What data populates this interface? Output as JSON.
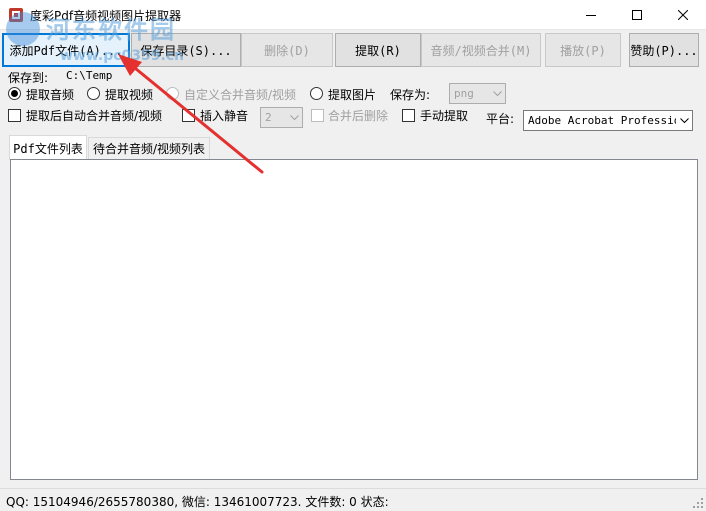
{
  "window": {
    "title": "度彩Pdf音频视频图片提取器"
  },
  "toolbar": {
    "add_pdf": "添加Pdf文件(A)...",
    "save_dir": "保存目录(S)...",
    "delete": "删除(D)",
    "extract": "提取(R)",
    "merge": "音频/视频合并(M)",
    "play": "播放(P)",
    "donate": "赞助(P)..."
  },
  "save": {
    "label": "保存到:",
    "path": "C:\\Temp",
    "save_as_label": "保存为:",
    "format": "png"
  },
  "options": {
    "extract_audio": "提取音频",
    "extract_video": "提取视频",
    "custom_merge": "自定义合并音频/视频",
    "extract_image": "提取图片",
    "auto_merge": "提取后自动合并音频/视频",
    "insert_silence": "插入静音",
    "silence_value": "2",
    "delete_after_merge": "合并后删除",
    "manual_extract": "手动提取",
    "platform_label": "平台:",
    "platform_value": "Adobe Acrobat Professional"
  },
  "tabs": [
    {
      "label": "Pdf文件列表",
      "active": true
    },
    {
      "label": "待合并音频/视频列表",
      "active": false
    }
  ],
  "status": {
    "text": "QQ: 15104946/2655780380, 微信: 13461007723. 文件数: 0  状态:"
  },
  "watermark": {
    "text": "河东软件园",
    "url": "www.pc0359.cn"
  },
  "colors": {
    "focus_blue": "#0078d7",
    "arrow_red": "#e53030"
  }
}
